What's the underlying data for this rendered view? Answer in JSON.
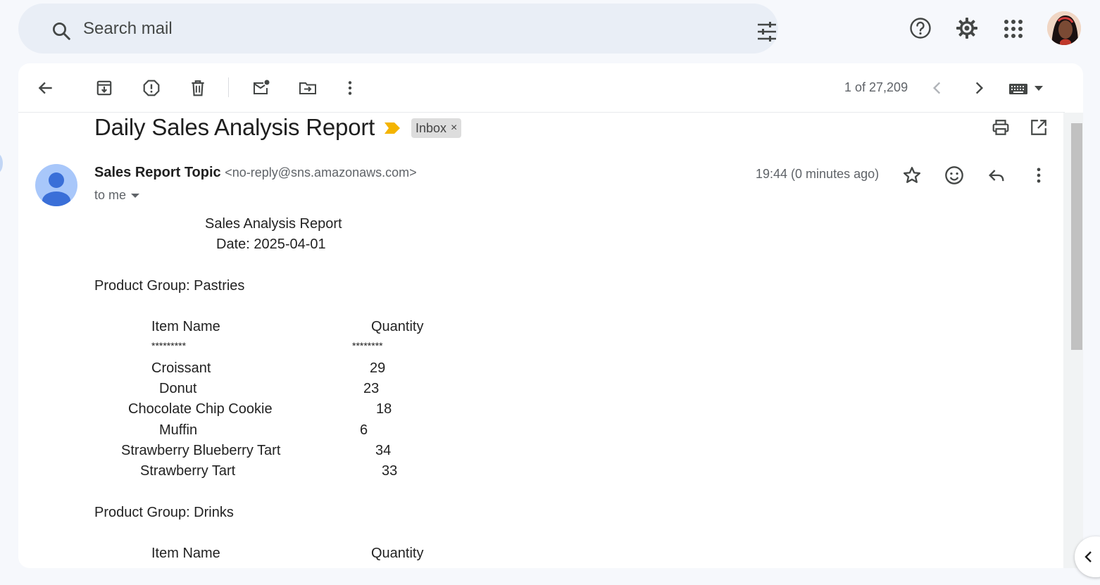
{
  "search": {
    "placeholder": "Search mail"
  },
  "toolbar": {
    "pager": "1 of 27,209"
  },
  "email": {
    "subject": "Daily Sales Analysis Report",
    "label": "Inbox",
    "label_close": "×",
    "sender_name": "Sales Report Topic",
    "sender_email": "<no-reply@sns.amazonaws.com>",
    "recipient": "to me",
    "time": "19:44 (0 minutes ago)"
  },
  "report": {
    "title": "Sales Analysis Report",
    "date": "Date: 2025-04-01",
    "groups": [
      {
        "heading": "Product Group: Pastries",
        "col_item": "Item Name",
        "col_qty": "Quantity",
        "item_stars": "*********",
        "qty_stars": "********",
        "rows": [
          {
            "name": "Croissant",
            "qty": "29"
          },
          {
            "name": "Donut",
            "qty": "23"
          },
          {
            "name": "Chocolate Chip Cookie",
            "qty": "18"
          },
          {
            "name": "Muffin",
            "qty": "6"
          },
          {
            "name": "Strawberry Blueberry Tart",
            "qty": "34"
          },
          {
            "name": "Strawberry Tart",
            "qty": "33"
          }
        ]
      },
      {
        "heading": "Product Group: Drinks",
        "col_item": "Item Name",
        "col_qty": "Quantity"
      }
    ]
  },
  "icons": {
    "search": "search-icon",
    "filter": "tune-icon",
    "help": "help-icon",
    "settings": "gear-icon",
    "apps": "apps-grid-icon",
    "back": "arrow-back-icon",
    "archive": "archive-icon",
    "spam": "report-spam-icon",
    "delete": "trash-icon",
    "mark_unread": "mark-unread-icon",
    "move": "move-to-icon",
    "more": "more-vert-icon",
    "prev": "chevron-left-icon",
    "next": "chevron-right-icon",
    "keyboard": "keyboard-icon",
    "print": "print-icon",
    "open_new": "open-in-new-icon",
    "star": "star-icon",
    "emoji": "emoji-icon",
    "reply": "reply-icon"
  },
  "colors": {
    "background": "#f6f8fc",
    "search_bg": "#e9eef6",
    "importance": "#f4b400",
    "label_bg": "#dddddd",
    "sender_avatar": "#a8c7fa"
  }
}
